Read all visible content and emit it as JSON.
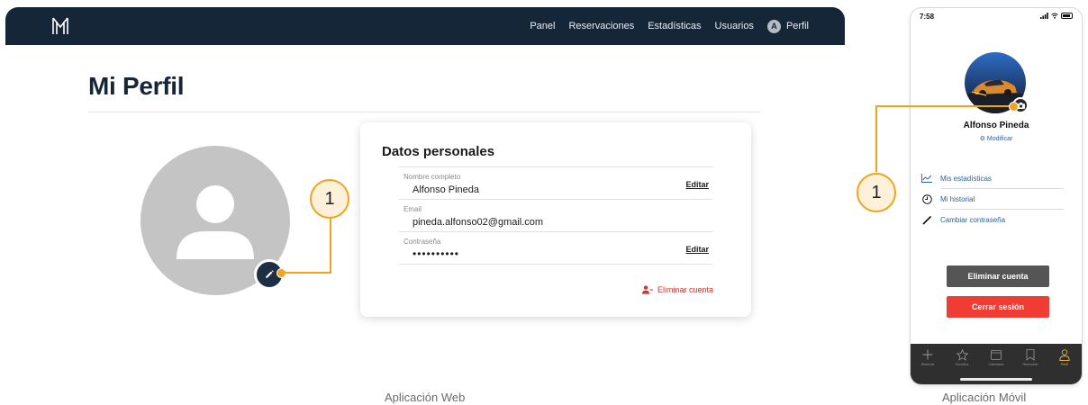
{
  "web": {
    "nav": {
      "logo_icon": "hotel-m-logo-icon",
      "links": [
        "Panel",
        "Reservaciones",
        "Estadísticas",
        "Usuarios"
      ],
      "profile_initial": "A",
      "profile_label": "Perfil"
    },
    "page_title": "Mi Perfil",
    "avatar_icon": "user-placeholder-icon",
    "edit_icon": "pencil-icon",
    "card": {
      "title": "Datos personales",
      "fields": [
        {
          "label": "Nombre completo",
          "value": "Alfonso Pineda",
          "action": "Editar"
        },
        {
          "label": "Email",
          "value": "pineda.alfonso02@gmail.com",
          "action": ""
        },
        {
          "label": "Contraseña",
          "value": "••••••••••",
          "action": "Editar"
        }
      ],
      "delete_label": "Eliminar cuenta",
      "delete_icon": "remove-user-icon"
    },
    "callout_number": "1",
    "caption": "Aplicación Web"
  },
  "mobile": {
    "status": {
      "time": "7:58"
    },
    "camera_icon": "camera-icon",
    "name": "Alfonso Pineda",
    "modify": "⚙ Modificar",
    "menu": [
      {
        "label": "Mis estadísticas",
        "icon": "chart-line-icon"
      },
      {
        "label": "Mi historial",
        "icon": "clock-icon"
      },
      {
        "label": "Cambiar contraseña",
        "icon": "pencil-icon"
      }
    ],
    "delete_button": "Eliminar cuenta",
    "logout_button": "Cerrar sesión",
    "tabs": [
      {
        "label": "Reservar",
        "icon": "plus-icon",
        "active": false
      },
      {
        "label": "Favoritos",
        "icon": "star-icon",
        "active": false
      },
      {
        "label": "Calendario",
        "icon": "calendar-icon",
        "active": false
      },
      {
        "label": "Reservado",
        "icon": "bookmark-icon",
        "active": false
      },
      {
        "label": "Perfil",
        "icon": "person-icon",
        "active": true
      }
    ],
    "callout_number": "1",
    "caption": "Aplicación Móvil"
  },
  "colors": {
    "nav_bg": "#152638",
    "title": "#152638",
    "callout": "#f2a31c",
    "danger": "#d8322d",
    "delete_button_bg": "#555555",
    "logout_button_bg": "#f03c33",
    "active_tab": "#e8b03f",
    "link": "#2a5ea8"
  }
}
